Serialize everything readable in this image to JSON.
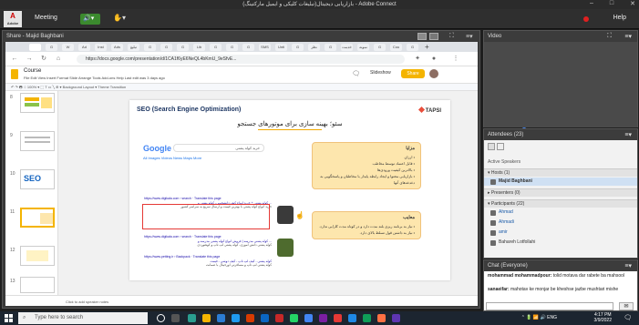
{
  "window": {
    "title": "بازاریابی دیجیتال(تبلیغات کلیکی و ایمیل مارکتینگ) - Adobe Connect",
    "min": "–",
    "max": "□",
    "close": "✕"
  },
  "menubar": {
    "logo_text": "Adobe",
    "meeting": "Meeting",
    "help": "Help"
  },
  "share_pod": {
    "title": "Share - Majid Baghbani"
  },
  "browser": {
    "url": "https://docs.google.com/presentation/d/1CA1f6yE6NeQL4bKmU_9eSfvE...",
    "tab_labels": [
      "Ad",
      "Inst",
      "Ads",
      "تبلیغ",
      "Lib",
      "SMS",
      "Unti",
      "نظر",
      "خدمت",
      "نمونه",
      "Cou"
    ]
  },
  "slides": {
    "doc_title": "Course",
    "menu": "File  Edit  View  Insert  Format  Slide  Arrange  Tools  Add-ons  Help  Last edit was 3 days ago",
    "slideshow": "Slideshow",
    "share": "Share",
    "toolbar": "↶ ↷ 🖶 ⌖  100% ▾   ⬚  T  ▭  ╲  ⊕  ▾      Background    Layout ▾    Theme    Transition",
    "speaker_notes": "Click to add speaker notes",
    "thumb_numbers": [
      "8",
      "9",
      "10",
      "11",
      "12",
      "13"
    ]
  },
  "slide": {
    "title": "SEO (Search Engine Optimization)",
    "brand": "TAPSI",
    "headline": "سئو؛ بهینه سازی برای موتورهای جستجو",
    "serp": {
      "google": "Google",
      "query": "خرید کوله پشتی",
      "tabs": "All   Images   Videos   News   Maps   More",
      "results": [
        {
          "url": "https://www.digikala.com › search  ·  Translate this page",
          "title": "کوله پشتی + خرید انواع کیف دانشجویی، کوله پشتی و ...",
          "desc": "خرید انواع کوله پشتی با بهترین قیمت و ارسال سریع به سراسر کشور"
        },
        {
          "url": "https://www.digikala.com › search  ·  Translate this page",
          "title": "کوله پشتی مدرسه | فروش انواع کوله پشتی مدرسه و ...",
          "desc": "کوله پشتی دانش آموزی، کوله پشتی لپ تاپ و کوهنوردی"
        },
        {
          "url": "https://www.petting.ir › Backpack  ·  Translate this page",
          "title": "کوله پشتی - کیف لپ تاپ - کیف دوشی - قیمت",
          "desc": "کوله پشتی لپ تاپ و مسافرتی اورجینال با ضمانت"
        }
      ]
    },
    "pros": {
      "title": "مزایا",
      "items": [
        "ارزان",
        "قابل اعتماد توسط مخاطب",
        "بالاترین کیفیت ورودی‌ها",
        "بازاریابی محتوا و ایجاد رابطه پایدار با مخاطبان و پاسخگویی به دغدغه‌های آنها"
      ]
    },
    "cons": {
      "title": "معایب",
      "items": [
        "نیاز به برنامه ریزی بلند مدت دارد و در کوتاه مدت کارایی ندارد.",
        "نیاز به داشتن قول تسلط بالای دارد."
      ]
    }
  },
  "video_pod": {
    "title": "Video"
  },
  "attendees": {
    "title": "Attendees",
    "count": "(23)",
    "active_speakers": "Active Speakers",
    "hosts": "Hosts (1)",
    "host_name": "Majid Baghbani",
    "presenters": "Presenters (0)",
    "participants": "Participants (22)",
    "participant_names": [
      "Ahmad",
      "Ahmadi",
      "amir",
      "Bahareh Lotfollahi"
    ]
  },
  "chat": {
    "title": "Chat",
    "scope": "(Everyone)",
    "messages": [
      {
        "sender": "mohammad mohammadpour:",
        "text": "tolid motava dar rabete ba mahsool"
      },
      {
        "sender": "sanaeifar:",
        "text": "mahotav ke monjar be kheshse jazbe mushtari mishe"
      }
    ]
  },
  "taskbar": {
    "search_placeholder": "Type here to search",
    "time": "4:17 PM",
    "date": "3/9/2022",
    "lang": "ENG"
  },
  "colors": {
    "accent": "#f4b400",
    "record": "#e02020",
    "slide_box": "#fde6ad"
  }
}
